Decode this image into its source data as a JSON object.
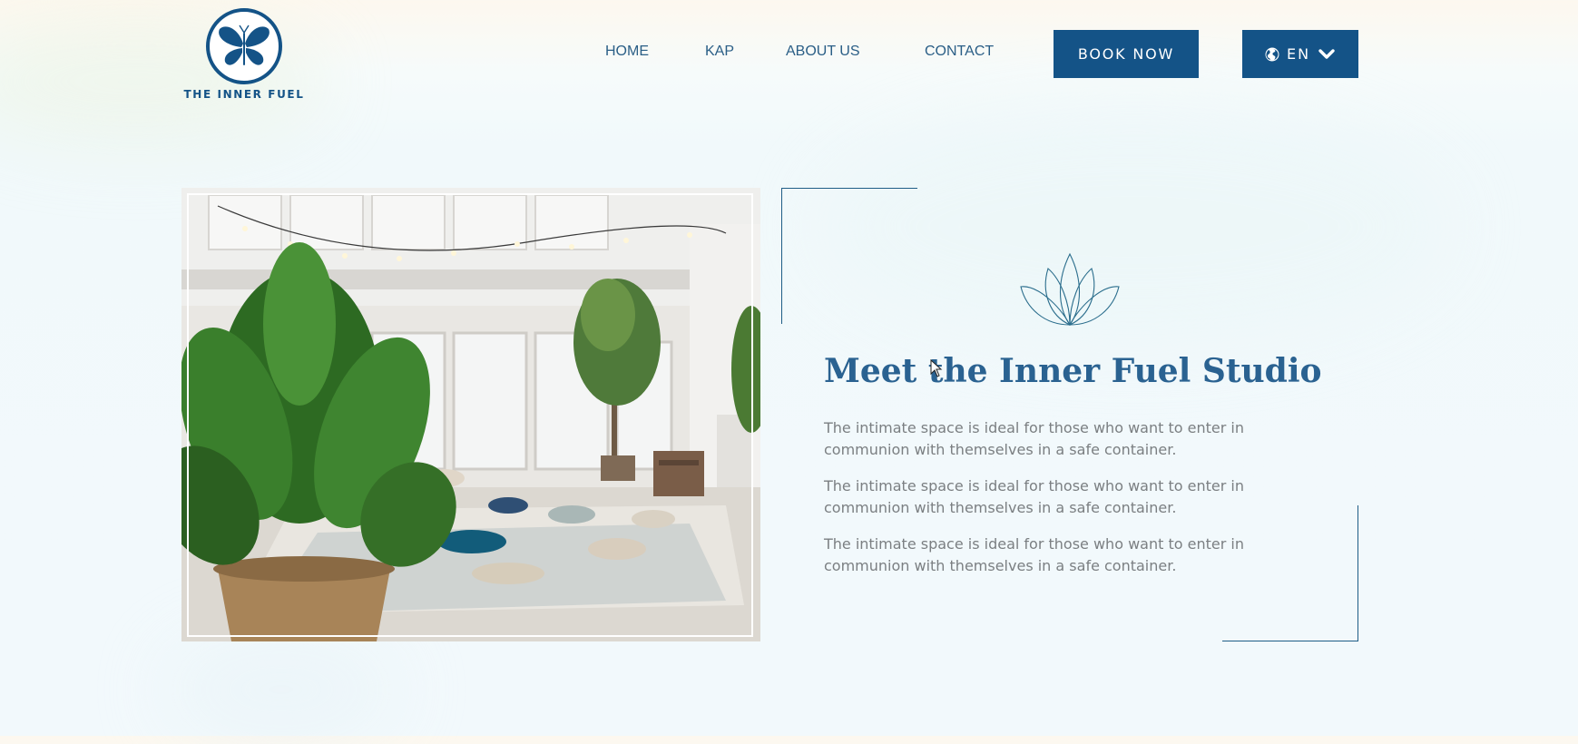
{
  "brand": {
    "name": "THE INNER FUEL",
    "logo_icon": "butterfly-icon"
  },
  "nav": {
    "items": [
      {
        "label": "HOME"
      },
      {
        "label": "KAP"
      },
      {
        "label": "ABOUT US"
      },
      {
        "label": "CONTACT"
      }
    ],
    "book_label": "BOOK NOW",
    "language": {
      "current": "EN",
      "icon": "globe-icon",
      "dropdown_icon": "chevron-down-icon"
    }
  },
  "studio": {
    "photo_subject": "studio-photo",
    "ornament_icon": "lotus-icon",
    "heading": "Meet the Inner Fuel Studio",
    "paragraphs": [
      "The intimate space is ideal for those who want to enter in communion with themselves in a safe container.",
      "The intimate space is ideal for those who want to enter in communion with themselves in a safe container.",
      "The intimate space is ideal for those who want to enter in communion with themselves in a safe container."
    ]
  },
  "colors": {
    "brand_blue": "#145387",
    "heading_blue": "#2a6291",
    "body_grey": "#7b7f82",
    "nav_text": "#4d6f84",
    "background": "#f2f9fc"
  }
}
